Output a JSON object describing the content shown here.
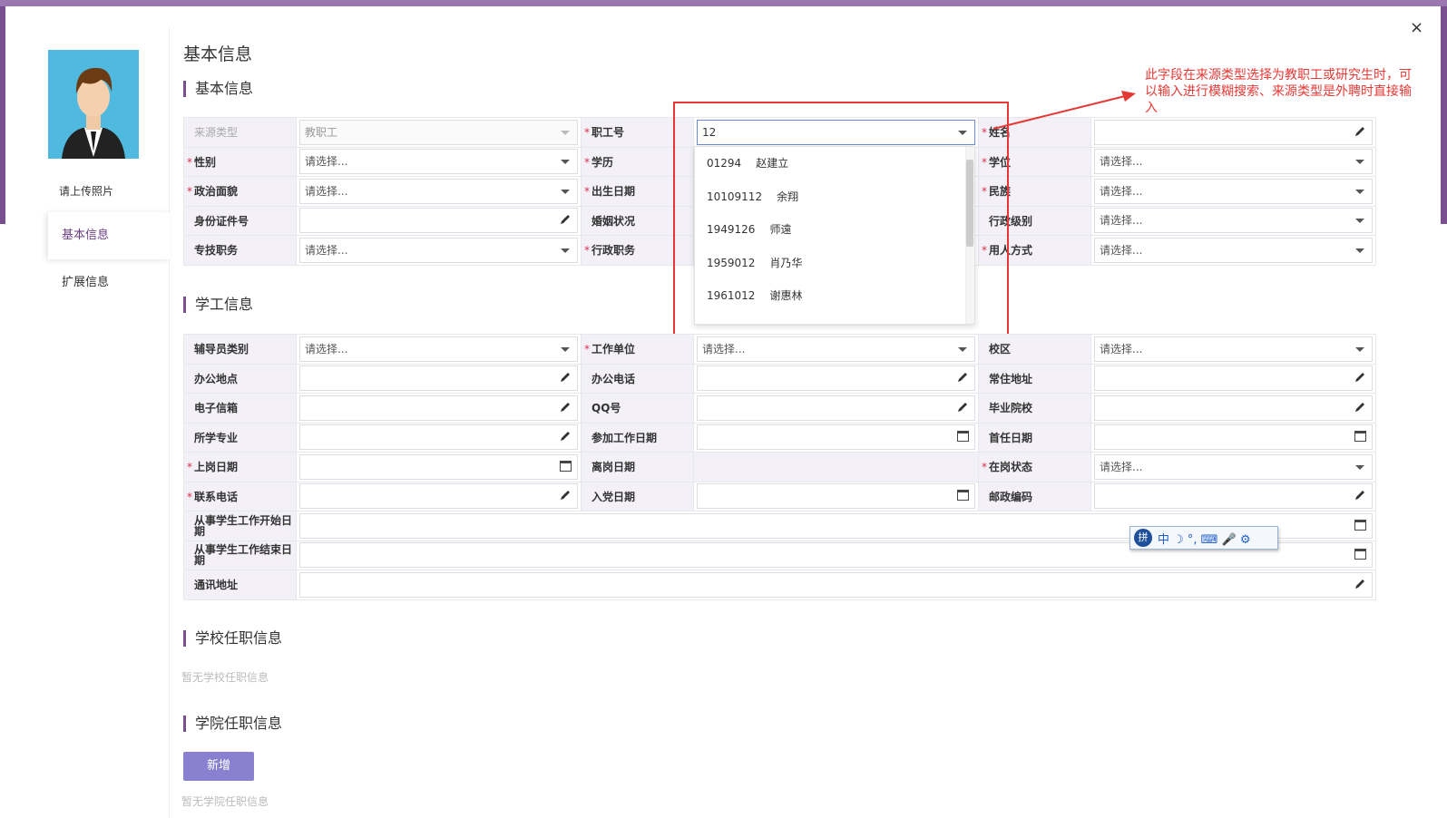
{
  "page": {
    "title": "基本信息",
    "close_icon": "×",
    "upload_photo": "请上传照片",
    "nav": [
      {
        "label": "基本信息",
        "active": true
      },
      {
        "label": "扩展信息",
        "active": false
      }
    ]
  },
  "sections": {
    "basic": "基本信息",
    "student_work": "学工信息",
    "school_post": "学校任职信息",
    "college_post": "学院任职信息"
  },
  "basic_form": {
    "source_type_label": "来源类型",
    "source_type_value": "教职工",
    "staff_no_label": "职工号",
    "staff_no_value": "12",
    "name_label": "姓名",
    "gender_label": "性别",
    "gender_placeholder": "请选择...",
    "education_label": "学历",
    "degree_label": "学位",
    "degree_placeholder": "请选择...",
    "political_label": "政治面貌",
    "political_placeholder": "请选择...",
    "birth_label": "出生日期",
    "ethnic_label": "民族",
    "ethnic_placeholder": "请选择...",
    "id_label": "身份证件号",
    "marriage_label": "婚姻状况",
    "admin_level_label": "行政级别",
    "admin_level_placeholder": "请选择...",
    "tech_post_label": "专技职务",
    "tech_post_placeholder": "请选择...",
    "admin_post_label": "行政职务",
    "employ_label": "用人方式",
    "employ_placeholder": "请选择..."
  },
  "dropdown": [
    {
      "code": "01294",
      "name": "赵建立"
    },
    {
      "code": "10109112",
      "name": "余翔"
    },
    {
      "code": "1949126",
      "name": "师遠"
    },
    {
      "code": "1959012",
      "name": "肖乃华"
    },
    {
      "code": "1961012",
      "name": "谢惠林"
    }
  ],
  "work_form": {
    "counselor_type_label": "辅导员类别",
    "counselor_type_placeholder": "请选择...",
    "work_unit_label": "工作单位",
    "work_unit_placeholder": "请选择...",
    "campus_label": "校区",
    "campus_placeholder": "请选择...",
    "office_label": "办公地点",
    "office_phone_label": "办公电话",
    "address_label": "常住地址",
    "email_label": "电子信箱",
    "qq_label": "QQ号",
    "grad_school_label": "毕业院校",
    "major_label": "所学专业",
    "work_start_label": "参加工作日期",
    "first_post_label": "首任日期",
    "onpost_label": "上岗日期",
    "offpost_label": "离岗日期",
    "onpost_status_label": "在岗状态",
    "onpost_status_placeholder": "请选择...",
    "phone_label": "联系电话",
    "party_label": "入党日期",
    "postcode_label": "邮政编码",
    "sw_start_label": "从事学生工作开始日期",
    "sw_end_label": "从事学生工作结束日期",
    "mail_addr_label": "通讯地址"
  },
  "annotation": "此字段在来源类型选择为教职工或研究生时，可以输入进行模糊搜索、来源类型是外聘时直接输入",
  "school_post_empty": "暂无学校任职信息",
  "college_add_button": "新增",
  "college_post_empty": "暂无学院任职信息",
  "ime_toolbar": {
    "logo": "拼",
    "chars": "中 ☽ °, ⌨ 🎤 ⚙"
  },
  "colors": {
    "accent": "#7a4f8f",
    "label_bg": "#f3f0f7",
    "required": "#d8324a",
    "annotation": "#e53935",
    "add_button": "#8a80d0"
  }
}
